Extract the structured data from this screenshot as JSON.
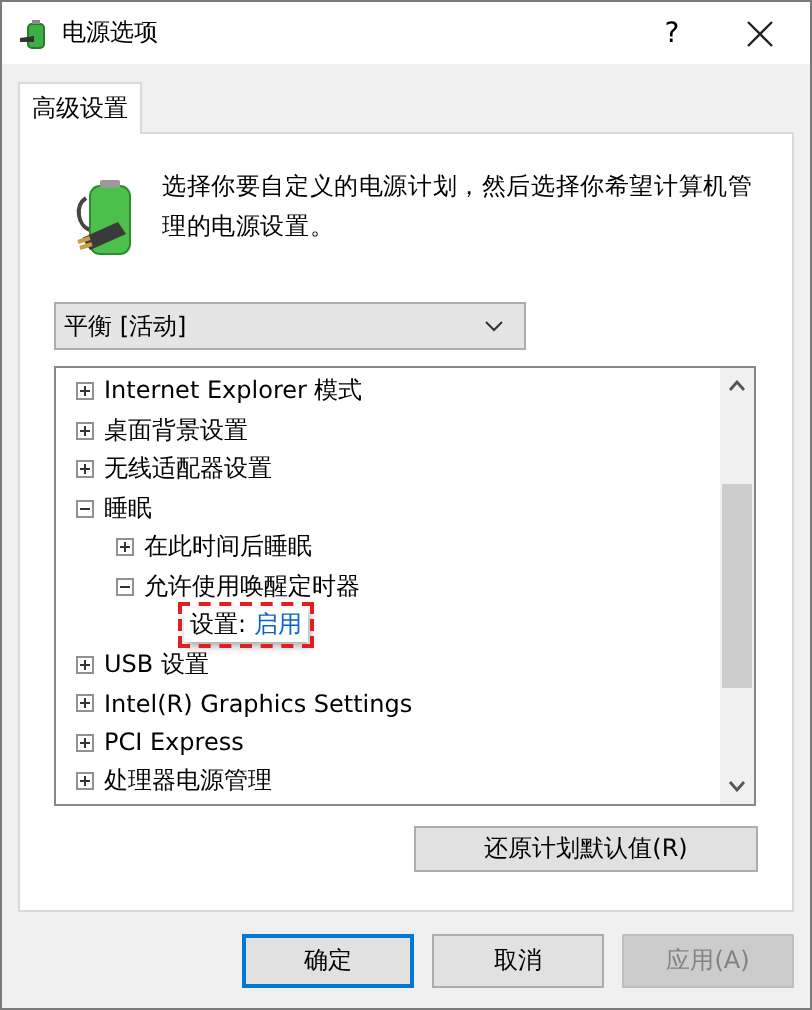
{
  "window": {
    "title": "电源选项",
    "help": "?"
  },
  "tabs": [
    {
      "label": "高级设置",
      "selected": true
    }
  ],
  "description": "选择你要自定义的电源计划，然后选择你希望计算机管理的电源设置。",
  "plan_dropdown": {
    "value": "平衡 [活动]"
  },
  "tree": [
    {
      "kind": "group",
      "label": "Internet Explorer 模式",
      "expanded": false
    },
    {
      "kind": "group",
      "label": "桌面背景设置",
      "expanded": false
    },
    {
      "kind": "group",
      "label": "无线适配器设置",
      "expanded": false
    },
    {
      "kind": "group",
      "label": "睡眠",
      "expanded": true,
      "children": [
        {
          "kind": "group",
          "label": "在此时间后睡眠",
          "expanded": false
        },
        {
          "kind": "group",
          "label": "允许使用唤醒定时器",
          "expanded": true,
          "children": [
            {
              "kind": "setting",
              "label": "设置:",
              "value": "启用",
              "highlighted": true
            }
          ]
        }
      ]
    },
    {
      "kind": "group",
      "label": "USB 设置",
      "expanded": false
    },
    {
      "kind": "group",
      "label": "Intel(R) Graphics Settings",
      "expanded": false
    },
    {
      "kind": "group",
      "label": "PCI Express",
      "expanded": false
    },
    {
      "kind": "group",
      "label": "处理器电源管理",
      "expanded": false
    }
  ],
  "restore_button": "还原计划默认值(R)",
  "buttons": [
    {
      "label": "确定",
      "default": true,
      "disabled": false
    },
    {
      "label": "取消",
      "default": false,
      "disabled": false
    },
    {
      "label": "应用(A)",
      "default": false,
      "disabled": true
    }
  ]
}
